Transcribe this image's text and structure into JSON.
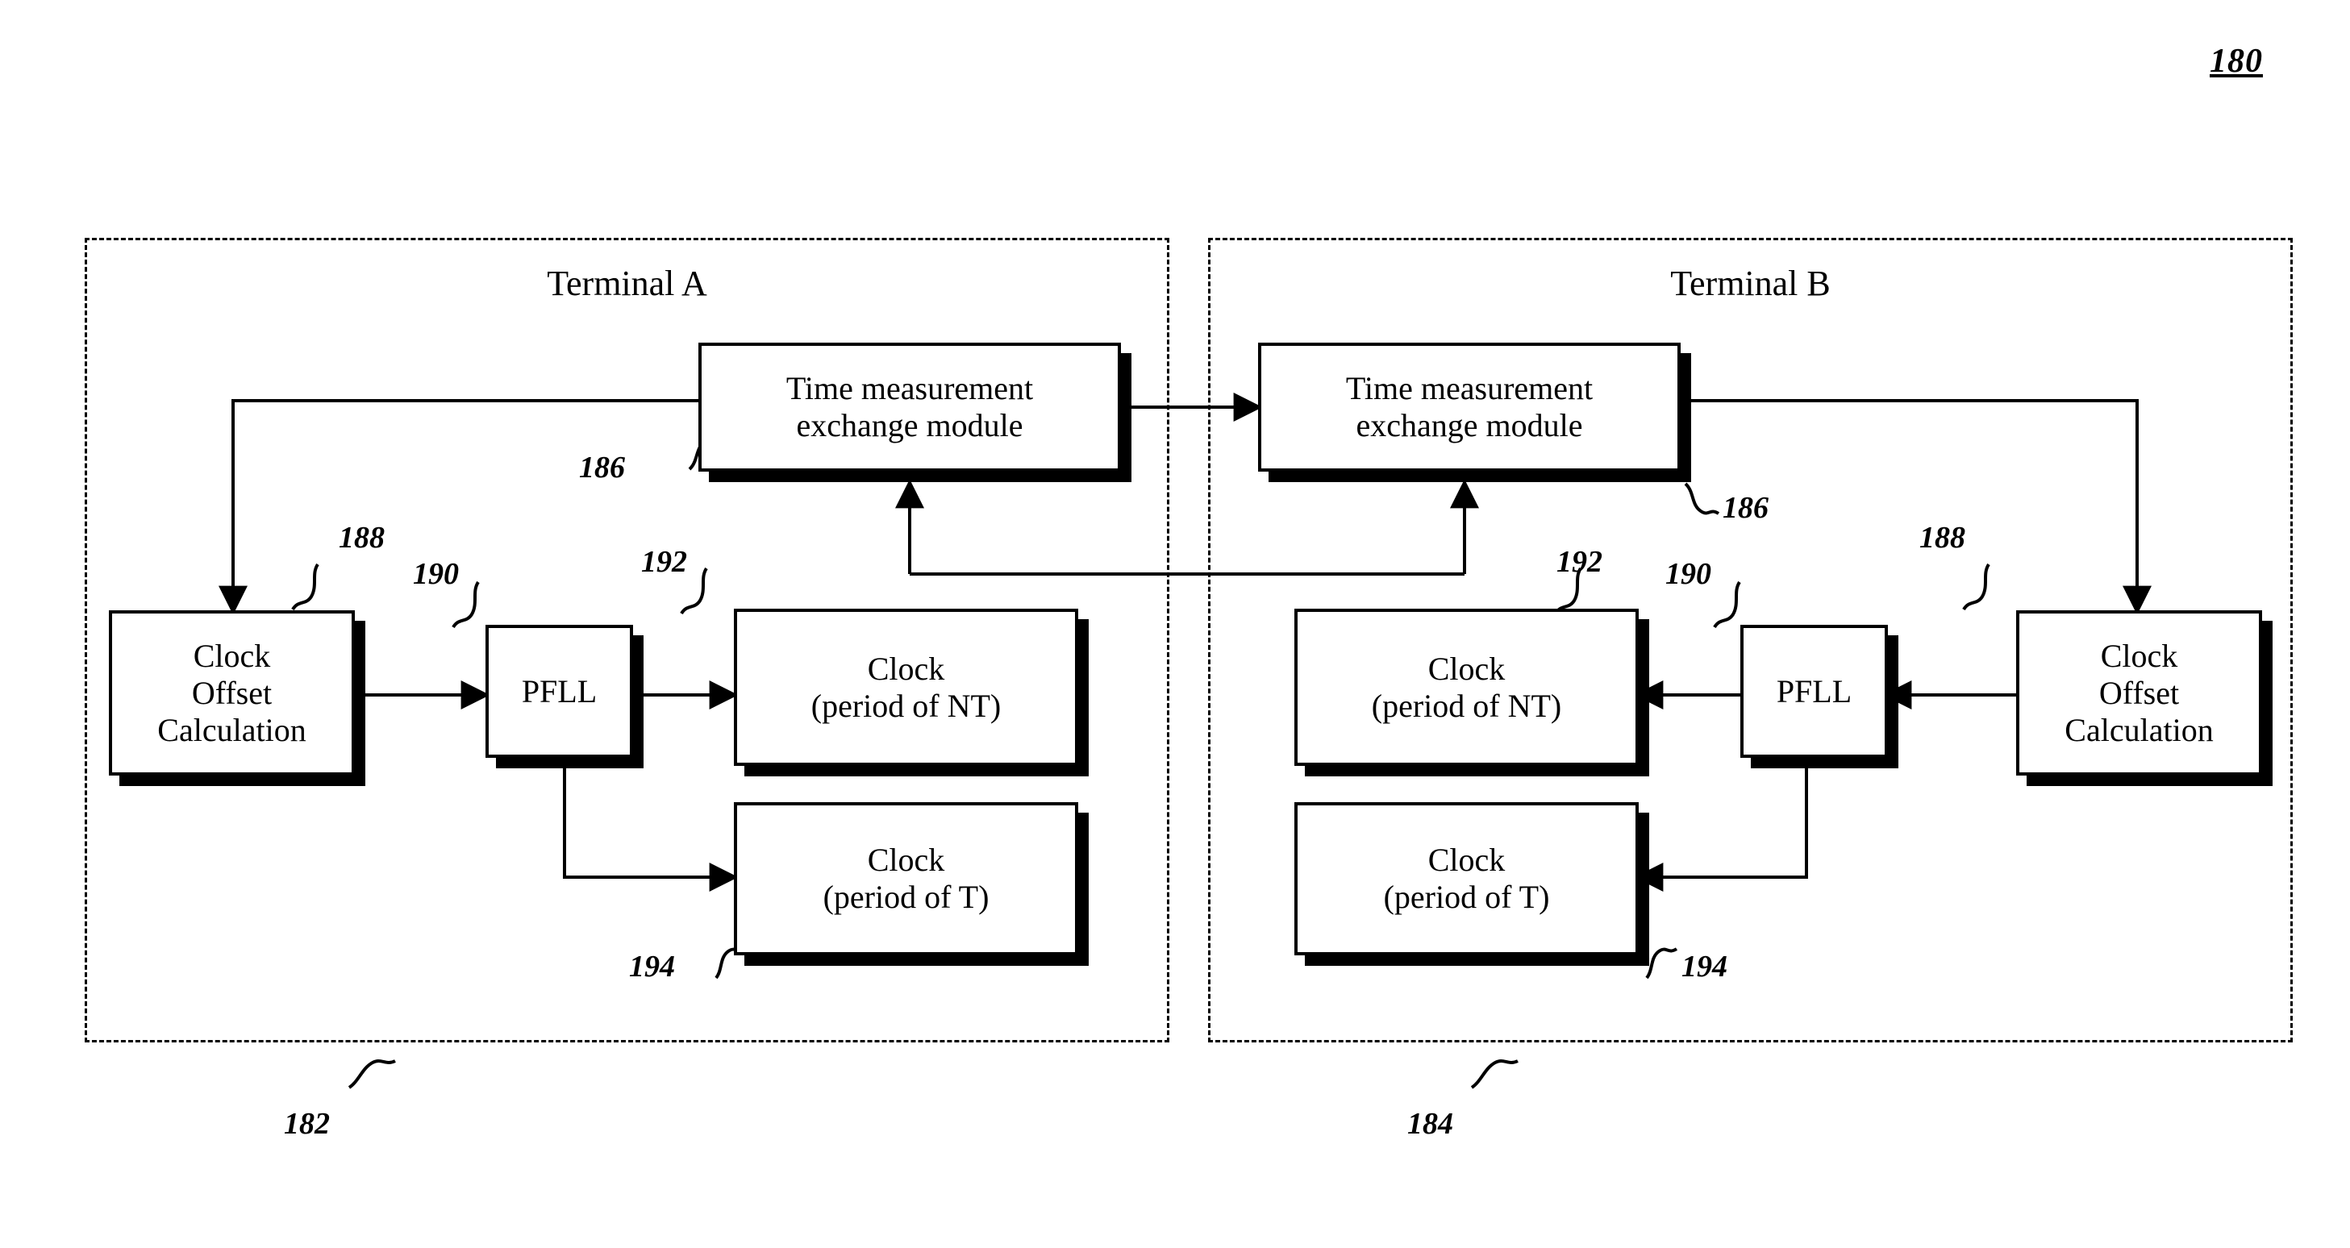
{
  "figure": {
    "number": "180"
  },
  "terminals": [
    {
      "id": "A",
      "title": "Terminal A",
      "ref": "182"
    },
    {
      "id": "B",
      "title": "Terminal B",
      "ref": "184"
    }
  ],
  "nodes": {
    "tme_a": {
      "label": "Time measurement\nexchange module",
      "ref": "186"
    },
    "tme_b": {
      "label": "Time measurement\nexchange module",
      "ref": "186"
    },
    "coc_a": {
      "label": "Clock\nOffset\nCalculation",
      "ref": "188"
    },
    "coc_b": {
      "label": "Clock\nOffset\nCalculation",
      "ref": "188"
    },
    "pfll_a": {
      "label": "PFLL",
      "ref": "190"
    },
    "pfll_b": {
      "label": "PFLL",
      "ref": "190"
    },
    "clk_nt_a": {
      "label": "Clock\n(period of NT)",
      "ref": "192"
    },
    "clk_nt_b": {
      "label": "Clock\n(period of NT)",
      "ref": "192"
    },
    "clk_t_a": {
      "label": "Clock\n(period of T)",
      "ref": "194"
    },
    "clk_t_b": {
      "label": "Clock\n(period of T)",
      "ref": "194"
    }
  },
  "colors": {
    "stroke": "#000000",
    "background": "#ffffff"
  }
}
